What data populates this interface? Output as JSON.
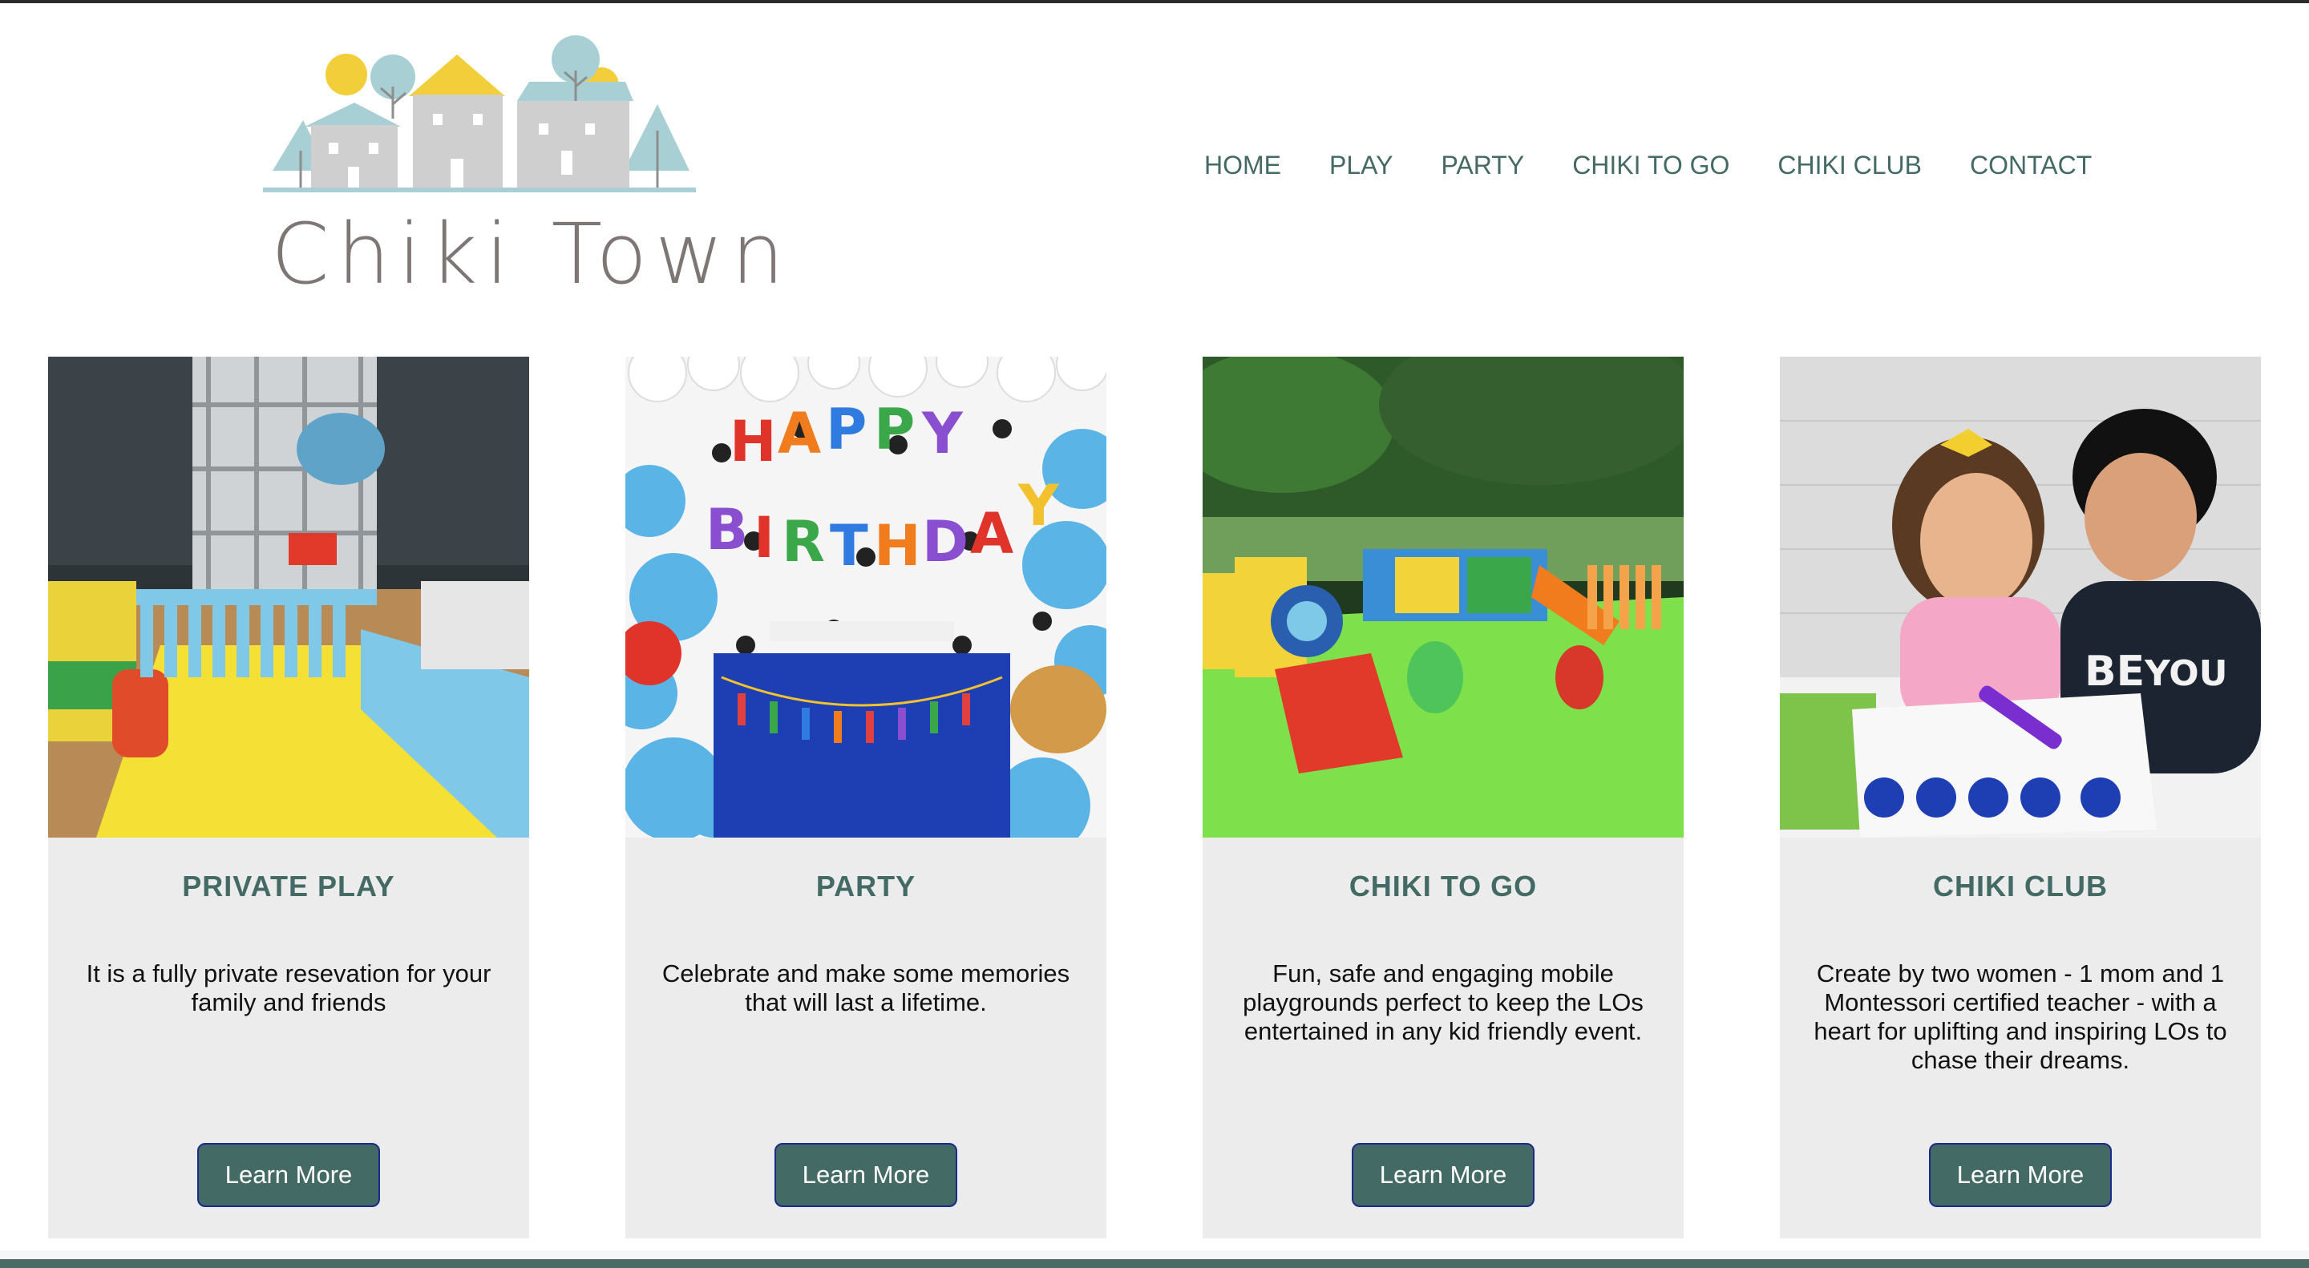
{
  "brand": {
    "name": "Chiki Town"
  },
  "nav": {
    "items": [
      {
        "label": "HOME"
      },
      {
        "label": "PLAY"
      },
      {
        "label": "PARTY"
      },
      {
        "label": "CHIKI TO GO"
      },
      {
        "label": "CHIKI CLUB"
      },
      {
        "label": "CONTACT"
      }
    ]
  },
  "cards": [
    {
      "title": "PRIVATE PLAY",
      "description": "It is a fully private resevation for your family and friends",
      "button": "Learn More"
    },
    {
      "title": "PARTY",
      "description": "Celebrate and make some memories that will last a lifetime.",
      "button": "Learn More"
    },
    {
      "title": "CHIKI TO GO",
      "description": "Fun, safe and engaging mobile playgrounds perfect to keep the LOs entertained in any kid friendly event.",
      "button": "Learn More"
    },
    {
      "title": "CHIKI CLUB",
      "description": "Create by two women - 1 mom and 1 Montessori certified teacher - with a heart for uplifting and inspiring LOs to chase their dreams.",
      "button": "Learn More"
    }
  ],
  "colors": {
    "accent": "#436a65",
    "card_bg": "#ececec",
    "button_border": "#1d2a8a",
    "logo_gray": "#cfcfcf",
    "logo_teal": "#a8cfd3",
    "logo_yellow": "#f2cf3a"
  }
}
